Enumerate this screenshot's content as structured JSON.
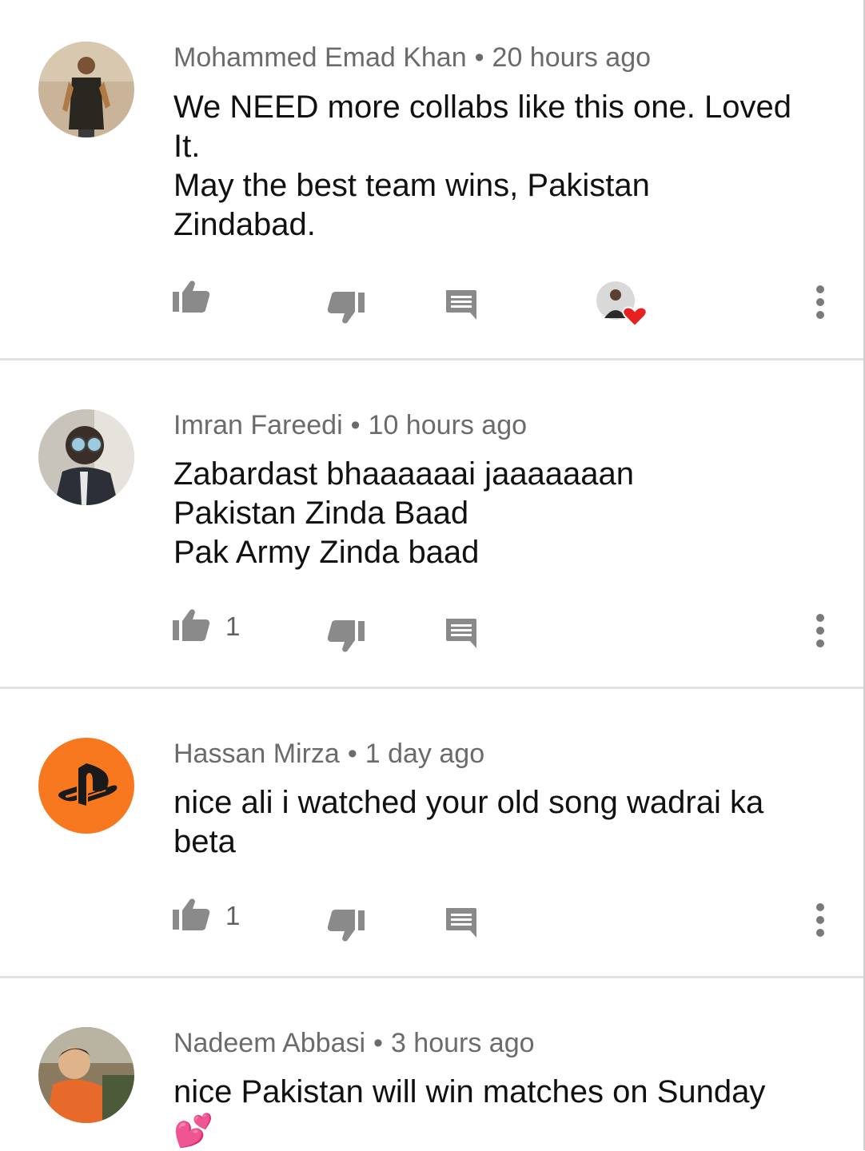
{
  "comments": [
    {
      "author": "Mohammed Emad Khan",
      "time": "20 hours ago",
      "lines": [
        "We NEED more collabs like this one. Loved",
        "It.",
        "May the best team wins, Pakistan",
        "Zindabad."
      ],
      "likes": "",
      "creator_hearted": true
    },
    {
      "author": "Imran Fareedi",
      "time": "10 hours ago",
      "lines": [
        "Zabardast bhaaaaaai jaaaaaaan",
        "Pakistan Zinda Baad",
        "Pak Army Zinda baad"
      ],
      "likes": "1",
      "creator_hearted": false
    },
    {
      "author": "Hassan Mirza",
      "time": "1 day ago",
      "lines": [
        "nice ali i watched your old song wadrai ka",
        "beta"
      ],
      "likes": "1",
      "creator_hearted": false
    },
    {
      "author": "Nadeem Abbasi",
      "time": "3 hours ago",
      "lines": [
        "nice Pakistan will win matches on Sunday",
        "💕"
      ],
      "likes": "",
      "creator_hearted": false
    }
  ],
  "separator": "•",
  "icons": {
    "like": "thumb-up-icon",
    "dislike": "thumb-down-icon",
    "reply": "reply-icon",
    "more": "more-vert-icon",
    "heart": "heart-icon"
  },
  "colors": {
    "icon": "#8a8a8a",
    "heart": "#e8201f",
    "playstation_avatar": "#f7781e",
    "divider": "#e2e2e2"
  }
}
